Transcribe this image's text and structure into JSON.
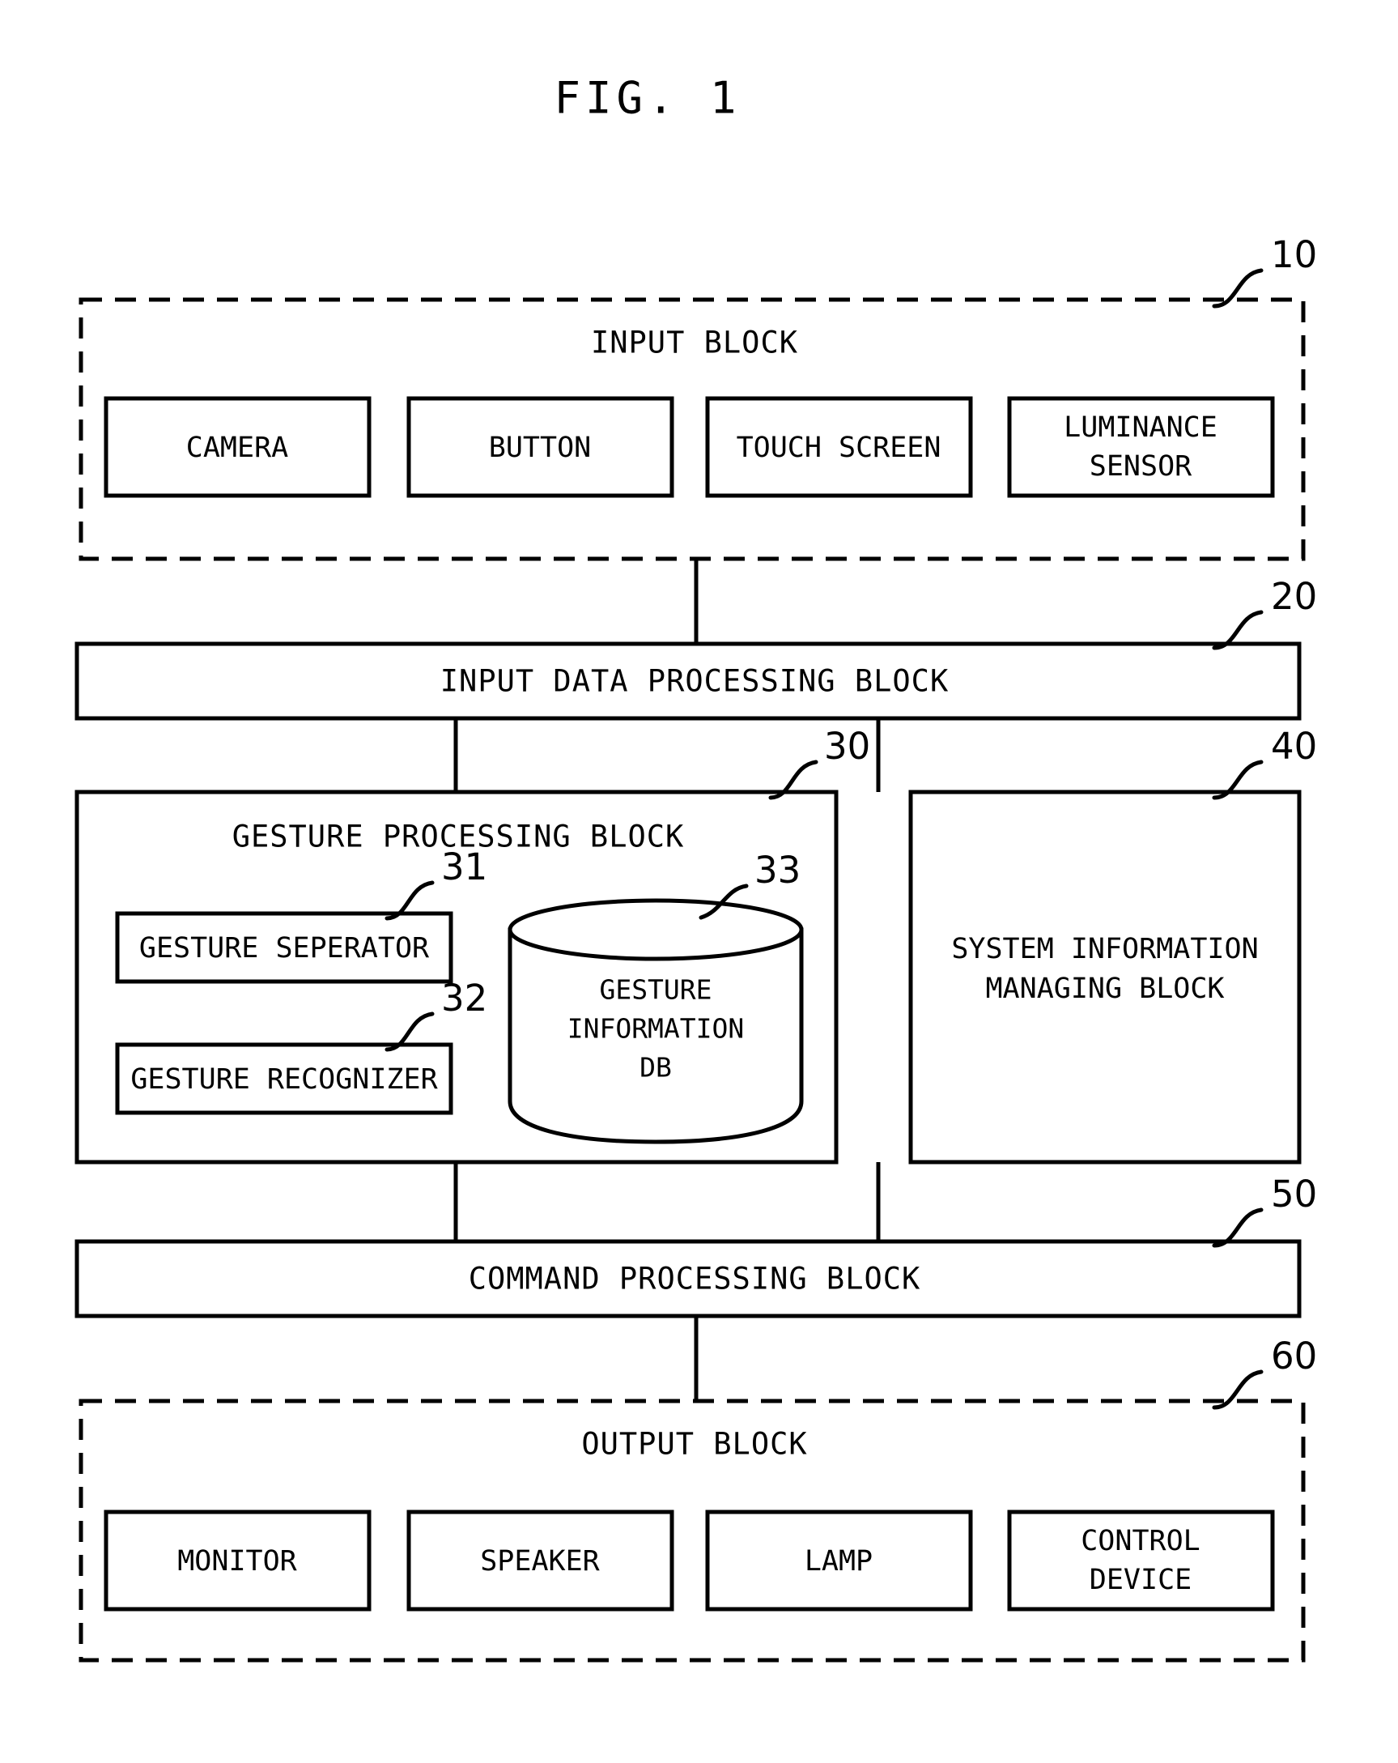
{
  "figure": {
    "title": "FIG. 1"
  },
  "blocks": {
    "input": {
      "label": "INPUT BLOCK",
      "ref": "10",
      "items": [
        {
          "label": "CAMERA"
        },
        {
          "label": "BUTTON"
        },
        {
          "label": "TOUCH SCREEN"
        },
        {
          "label_line1": "LUMINANCE",
          "label_line2": "SENSOR"
        }
      ]
    },
    "input_data_processing": {
      "label": "INPUT DATA PROCESSING BLOCK",
      "ref": "20"
    },
    "gesture_processing": {
      "label": "GESTURE PROCESSING BLOCK",
      "ref": "30",
      "separator": {
        "label": "GESTURE SEPERATOR",
        "ref": "31"
      },
      "recognizer": {
        "label": "GESTURE RECOGNIZER",
        "ref": "32"
      },
      "database": {
        "ref": "33",
        "label_line1": "GESTURE",
        "label_line2": "INFORMATION",
        "label_line3": "DB"
      }
    },
    "system_information_managing": {
      "label_line1": "SYSTEM INFORMATION",
      "label_line2": "MANAGING BLOCK",
      "ref": "40"
    },
    "command_processing": {
      "label": "COMMAND PROCESSING BLOCK",
      "ref": "50"
    },
    "output": {
      "label": "OUTPUT BLOCK",
      "ref": "60",
      "items": [
        {
          "label": "MONITOR"
        },
        {
          "label": "SPEAKER"
        },
        {
          "label": "LAMP"
        },
        {
          "label_line1": "CONTROL",
          "label_line2": "DEVICE"
        }
      ]
    }
  },
  "colors": {
    "ink": "#000000",
    "paper": "#ffffff"
  }
}
